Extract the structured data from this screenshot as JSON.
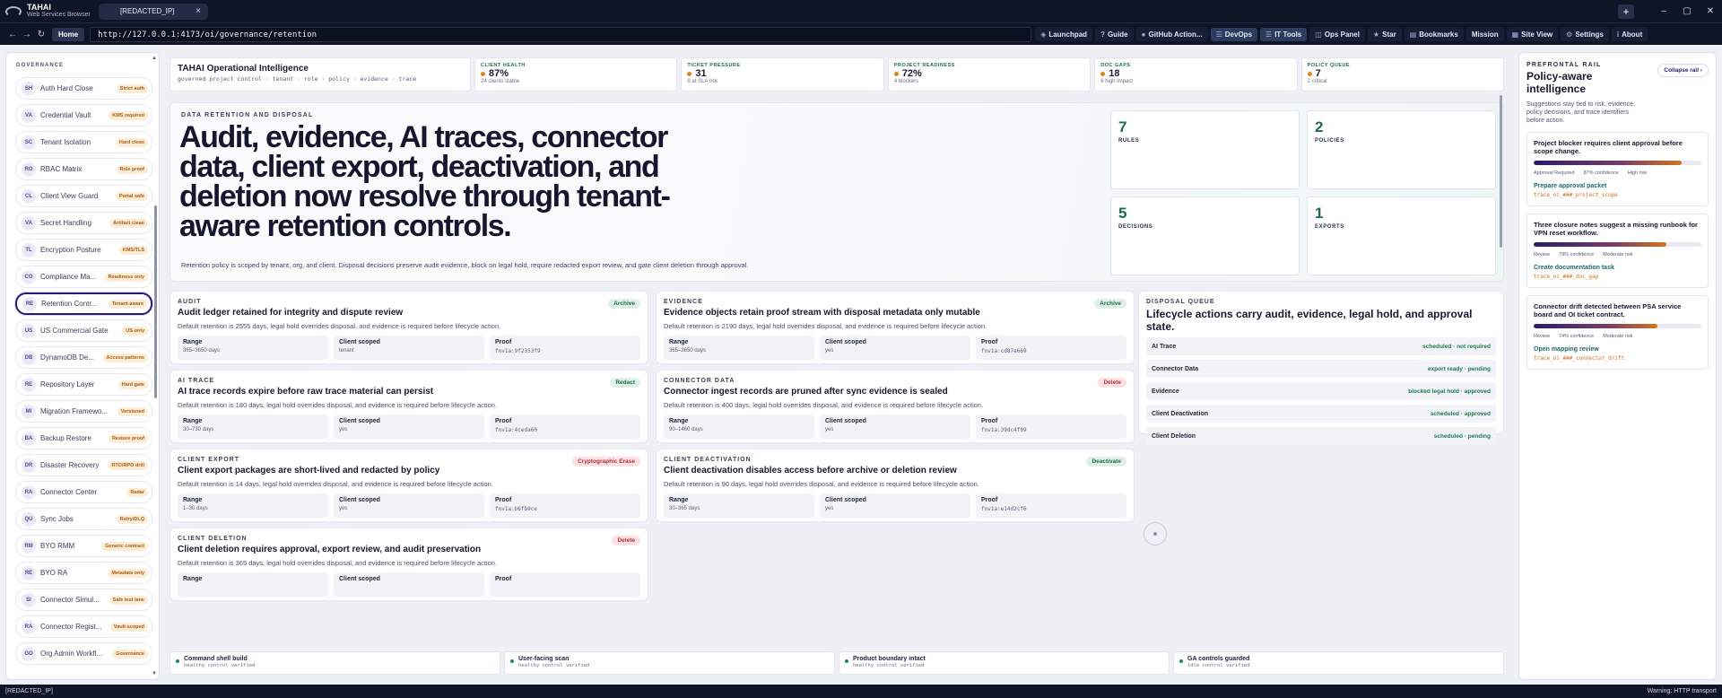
{
  "app": {
    "brand_name": "TAHAI",
    "brand_sub": "Web Services Browser",
    "tab_label": "[REDACTED_IP]",
    "tab_close": "×",
    "new_tab": "+",
    "win_min": "–",
    "win_max": "▢",
    "win_close": "✕"
  },
  "nav": {
    "back": "←",
    "forward": "→",
    "reload": "↻",
    "home": "Home",
    "url": "http://127.0.0.1:4173/oi/governance/retention",
    "items": [
      {
        "icon": "◈",
        "label": "Launchpad"
      },
      {
        "icon": "?",
        "label": "Guide"
      },
      {
        "icon": "●",
        "label": "GitHub Action..."
      },
      {
        "icon": "☰",
        "label": "DevOps"
      },
      {
        "icon": "☰",
        "label": "IT Tools"
      },
      {
        "icon": "◫",
        "label": "Ops Panel"
      },
      {
        "icon": "★",
        "label": "Star"
      },
      {
        "icon": "▤",
        "label": "Bookmarks"
      },
      {
        "icon": "",
        "label": "Mission"
      },
      {
        "icon": "▦",
        "label": "Site View"
      },
      {
        "icon": "⚙",
        "label": "Settings"
      },
      {
        "icon": "i",
        "label": "About"
      }
    ]
  },
  "sidebar": {
    "heading": "GOVERNANCE",
    "scroll_up": "▲",
    "scroll_down": "▼",
    "items": [
      {
        "abbr": "SH",
        "label": "Auth Hard Close",
        "badge": "Strict auth"
      },
      {
        "abbr": "VA",
        "label": "Credential Vault",
        "badge": "KMS required"
      },
      {
        "abbr": "SC",
        "label": "Tenant Isolation",
        "badge": "Hard close"
      },
      {
        "abbr": "RO",
        "label": "RBAC Matrix",
        "badge": "Role proof"
      },
      {
        "abbr": "CL",
        "label": "Client View Guard",
        "badge": "Portal safe"
      },
      {
        "abbr": "VA",
        "label": "Secret Handling",
        "badge": "Artifact clean"
      },
      {
        "abbr": "TL",
        "label": "Encryption Posture",
        "badge": "KMS/TLS"
      },
      {
        "abbr": "CO",
        "label": "Compliance Ma...",
        "badge": "Readiness only"
      },
      {
        "abbr": "RE",
        "label": "Retention Contr...",
        "badge": "Tenant-aware"
      },
      {
        "abbr": "US",
        "label": "US Commercial Gate",
        "badge": "US-only"
      },
      {
        "abbr": "DB",
        "label": "DynamoDB De...",
        "badge": "Access patterns"
      },
      {
        "abbr": "RE",
        "label": "Repository Layer",
        "badge": "Hard gate"
      },
      {
        "abbr": "MI",
        "label": "Migration Framewo...",
        "badge": "Versioned"
      },
      {
        "abbr": "BA",
        "label": "Backup Restore",
        "badge": "Restore proof"
      },
      {
        "abbr": "DR",
        "label": "Disaster Recovery",
        "badge": "RTO/RPO drill"
      },
      {
        "abbr": "RA",
        "label": "Connector Center",
        "badge": "Radar"
      },
      {
        "abbr": "QU",
        "label": "Sync Jobs",
        "badge": "Retry/DLQ"
      },
      {
        "abbr": "RM",
        "label": "BYO RMM",
        "badge": "Generic contract"
      },
      {
        "abbr": "RE",
        "label": "BYO RA",
        "badge": "Metadata only"
      },
      {
        "abbr": "SI",
        "label": "Connector Simul...",
        "badge": "Safe test lane"
      },
      {
        "abbr": "RA",
        "label": "Connector Regist...",
        "badge": "Vault-scoped"
      },
      {
        "abbr": "GO",
        "label": "Org Admin Workfl...",
        "badge": "Governance"
      }
    ]
  },
  "summary": {
    "title": "TAHAI Operational Intelligence",
    "subtitle": "governed project control · tenant · role · policy · evidence · trace",
    "kpis": [
      {
        "label": "CLIENT HEALTH",
        "value": "87%",
        "sub": "24 clients stable"
      },
      {
        "label": "TICKET PRESSURE",
        "value": "31",
        "sub": "9 at SLA risk"
      },
      {
        "label": "PROJECT READINESS",
        "value": "72%",
        "sub": "4 blockers"
      },
      {
        "label": "DOC GAPS",
        "value": "18",
        "sub": "6 high impact"
      },
      {
        "label": "POLICY QUEUE",
        "value": "7",
        "sub": "2 critical"
      }
    ]
  },
  "hero": {
    "eyebrow": "DATA RETENTION AND DISPOSAL",
    "title": "Audit, evidence, AI traces, connector data, client export, deactivation, and deletion now resolve through tenant-aware retention controls.",
    "description": "Retention policy is scoped by tenant, org, and client. Disposal decisions preserve audit evidence, block on legal hold, require redacted export review, and gate client deletion through approval.",
    "stats": [
      {
        "number": "7",
        "label": "RULES"
      },
      {
        "number": "2",
        "label": "POLICIES"
      },
      {
        "number": "5",
        "label": "DECISIONS"
      },
      {
        "number": "1",
        "label": "EXPORTS"
      }
    ]
  },
  "cards": [
    {
      "eyebrow": "AUDIT",
      "tag": "Archive",
      "tag_tone": "green",
      "title": "Audit ledger retained for integrity and dispute review",
      "desc": "Default retention is 2555 days, legal hold overrides disposal, and evidence is required before lifecycle action.",
      "range_label": "Range",
      "range": "365–3650 days",
      "scope_label": "Client scoped",
      "scope": "tenant",
      "proof_label": "Proof",
      "proof": "fnv1a:9f2353f9"
    },
    {
      "eyebrow": "EVIDENCE",
      "tag": "Archive",
      "tag_tone": "green",
      "title": "Evidence objects retain proof stream with disposal metadata only mutable",
      "desc": "Default retention is 2190 days, legal hold overrides disposal, and evidence is required before lifecycle action.",
      "range_label": "Range",
      "range": "365–3650 days",
      "scope_label": "Client scoped",
      "scope": "yes",
      "proof_label": "Proof",
      "proof": "fnv1a:cd87e669"
    },
    {
      "eyebrow": "AI TRACE",
      "tag": "Redact",
      "tag_tone": "green",
      "title": "AI trace records expire before raw trace material can persist",
      "desc": "Default retention is 180 days, legal hold overrides disposal, and evidence is required before lifecycle action.",
      "range_label": "Range",
      "range": "30–730 days",
      "scope_label": "Client scoped",
      "scope": "yes",
      "proof_label": "Proof",
      "proof": "fnv1a:4ceda60"
    },
    {
      "eyebrow": "CONNECTOR DATA",
      "tag": "Delete",
      "tag_tone": "red",
      "title": "Connector ingest records are pruned after sync evidence is sealed",
      "desc": "Default retention is 400 days, legal hold overrides disposal, and evidence is required before lifecycle action.",
      "range_label": "Range",
      "range": "90–1460 days",
      "scope_label": "Client scoped",
      "scope": "yes",
      "proof_label": "Proof",
      "proof": "fnv1a:39dc4f09"
    },
    {
      "eyebrow": "CLIENT EXPORT",
      "tag": "Cryptographic Erase",
      "tag_tone": "red",
      "title": "Client export packages are short-lived and redacted by policy",
      "desc": "Default retention is 14 days, legal hold overrides disposal, and evidence is required before lifecycle action.",
      "range_label": "Range",
      "range": "1–30 days",
      "scope_label": "Client scoped",
      "scope": "yes",
      "proof_label": "Proof",
      "proof": "fnv1a:b6fb9ce"
    },
    {
      "eyebrow": "CLIENT DEACTIVATION",
      "tag": "Deactivate",
      "tag_tone": "green",
      "title": "Client deactivation disables access before archive or deletion review",
      "desc": "Default retention is 90 days, legal hold overrides disposal, and evidence is required before lifecycle action.",
      "range_label": "Range",
      "range": "30–365 days",
      "scope_label": "Client scoped",
      "scope": "yes",
      "proof_label": "Proof",
      "proof": "fnv1a:e14d2cf6"
    },
    {
      "eyebrow": "CLIENT DELETION",
      "tag": "Delete",
      "tag_tone": "red",
      "title": "Client deletion requires approval, export review, and audit preservation",
      "desc": "Default retention is 365 days, legal hold overrides disposal, and evidence is required before lifecycle action.",
      "range_label": "Range",
      "range": "",
      "scope_label": "Client scoped",
      "scope": "",
      "proof_label": "Proof",
      "proof": ""
    }
  ],
  "queue": {
    "eyebrow": "DISPOSAL QUEUE",
    "title": "Lifecycle actions carry audit, evidence, legal hold, and approval state.",
    "rows": [
      {
        "label": "AI Trace",
        "status": "scheduled · not required"
      },
      {
        "label": "Connector Data",
        "status": "export ready · pending"
      },
      {
        "label": "Evidence",
        "status": "blocked legal hold · approved"
      },
      {
        "label": "Client Deactivation",
        "status": "scheduled · approved"
      },
      {
        "label": "Client Deletion",
        "status": "scheduled · pending"
      }
    ]
  },
  "checks": [
    {
      "title": "Command shell build",
      "sub": "healthy control verified"
    },
    {
      "title": "User-facing scan",
      "sub": "healthy control verified"
    },
    {
      "title": "Product boundary intact",
      "sub": "healthy control verified"
    },
    {
      "title": "GA controls guarded",
      "sub": "idle control verified"
    }
  ],
  "rail": {
    "eyebrow": "PREFRONTAL RAIL",
    "title": "Policy-aware intelligence",
    "collapse": "Collapse rail ›",
    "description": "Suggestions stay tied to risk, evidence, policy decisions, and trace identifiers before action.",
    "suggestions": [
      {
        "title": "Project blocker requires client approval before scope change.",
        "progress": 0.88,
        "chips": [
          "Approval Required",
          "87% confidence",
          "High risk"
        ],
        "action": "Prepare approval packet",
        "ref": "trace_oi_###_project_scope"
      },
      {
        "title": "Three closure notes suggest a missing runbook for VPN reset workflow.",
        "progress": 0.79,
        "chips": [
          "Review",
          "79% confidence",
          "Moderate risk"
        ],
        "action": "Create documentation task",
        "ref": "trace_oi_###_doc_gap"
      },
      {
        "title": "Connector drift detected between PSA service board and OI ticket contract.",
        "progress": 0.74,
        "chips": [
          "Review",
          "74% confidence",
          "Moderate risk"
        ],
        "action": "Open mapping review",
        "ref": "trace_oi_###_connector_drift"
      }
    ]
  },
  "statusbar": {
    "left": "[REDACTED_IP]",
    "right": "Warning: HTTP transport"
  }
}
